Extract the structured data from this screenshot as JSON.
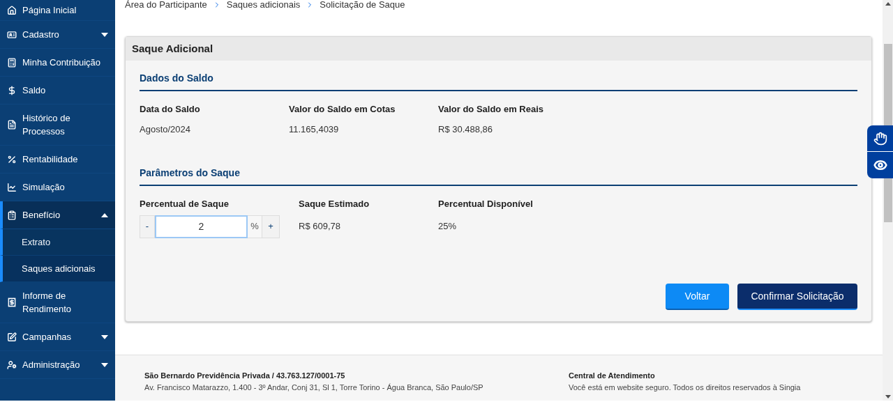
{
  "sidebar": {
    "items": [
      {
        "label": "Página Inicial",
        "selected": false
      },
      {
        "label": "Cadastro",
        "selected": false,
        "expanded": false
      },
      {
        "label": "Minha Contribuição",
        "selected": false
      },
      {
        "label": "Saldo",
        "selected": false
      },
      {
        "label": "Histórico de Processos",
        "selected": false
      },
      {
        "label": "Rentabilidade",
        "selected": false
      },
      {
        "label": "Simulação",
        "selected": false
      },
      {
        "label": "Benefício",
        "selected": true,
        "expanded": true,
        "children": [
          {
            "label": "Extrato",
            "selected": false
          },
          {
            "label": "Saques adicionais",
            "selected": true
          }
        ]
      },
      {
        "label": "Informe de Rendimento",
        "selected": false
      },
      {
        "label": "Campanhas",
        "selected": false,
        "expanded": false
      },
      {
        "label": "Administração",
        "selected": false,
        "expanded": false
      }
    ]
  },
  "breadcrumb": [
    "Área do Participante",
    "Saques adicionais",
    "Solicitação de Saque"
  ],
  "card": {
    "title": "Saque Adicional",
    "balance": {
      "heading": "Dados do Saldo",
      "fields": [
        {
          "label": "Data do Saldo",
          "value": "Agosto/2024"
        },
        {
          "label": "Valor do Saldo em Cotas",
          "value": "11.165,4039"
        },
        {
          "label": "Valor do Saldo em Reais",
          "value": "R$ 30.488,86"
        }
      ]
    },
    "params": {
      "heading": "Parâmetros do Saque",
      "percent_label": "Percentual de Saque",
      "decrement": "-",
      "value": "2",
      "unit": "%",
      "increment": "+",
      "fields": [
        {
          "label": "Saque Estimado",
          "value": "R$ 609,78"
        },
        {
          "label": "Percentual Disponível",
          "value": "25%"
        }
      ]
    },
    "buttons": [
      {
        "label": "Voltar",
        "kind": "secondary"
      },
      {
        "label": "Confirmar Solicitação",
        "kind": "primary"
      }
    ]
  },
  "footer": [
    {
      "title": "São Bernardo Previdência Privada / 43.763.127/0001-75",
      "text": "Av. Francisco Matarazzo, 1.400 - 3º Andar, Conj 31, Sl 1, Torre Torino - Água Branca, São Paulo/SP"
    },
    {
      "title": "Central de Atendimento",
      "text": "Você está em website seguro. Todos os direitos reservados à Singia"
    }
  ]
}
